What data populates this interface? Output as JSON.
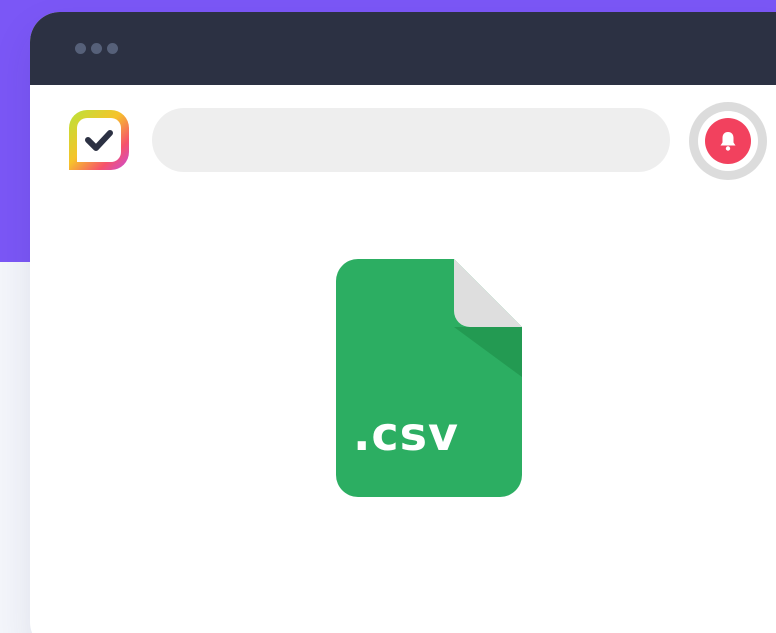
{
  "window": {
    "titlebar_dots": [
      "dot",
      "dot",
      "dot"
    ]
  },
  "toolbar": {
    "logo_icon": "check-badge-icon",
    "search_placeholder": "",
    "notification_icon": "bell-icon"
  },
  "file": {
    "extension_label": ".csv",
    "icon": "file-csv-icon",
    "color": "#2cae62"
  },
  "colors": {
    "background_accent": "#7b57f6",
    "titlebar": "#2c3143",
    "notification": "#f2415e"
  }
}
